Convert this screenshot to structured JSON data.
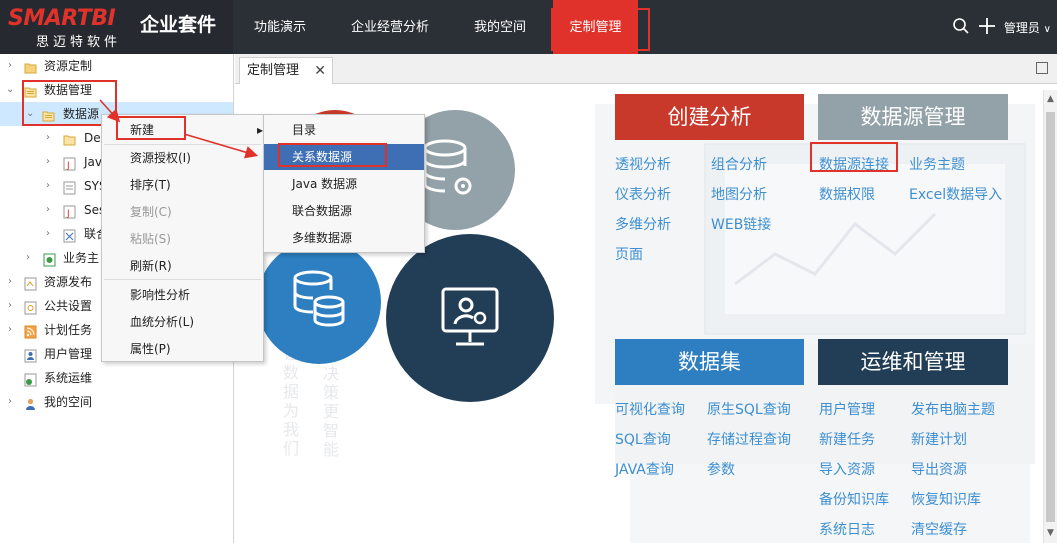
{
  "brand": {
    "logo": "SMARTBI",
    "suite": "企业套件",
    "cn_name": "思迈特软件"
  },
  "nav": [
    "功能演示",
    "企业经营分析",
    "我的空间",
    "定制管理"
  ],
  "user": {
    "label": "管理员",
    "caret": "∨"
  },
  "tree": [
    {
      "label": "资源定制"
    },
    {
      "label": "数据管理"
    },
    {
      "label": "数据源"
    },
    {
      "label": "De"
    },
    {
      "label": "Jav"
    },
    {
      "label": "SYS"
    },
    {
      "label": "Ses"
    },
    {
      "label": "联合"
    },
    {
      "label": "业务主"
    },
    {
      "label": "资源发布"
    },
    {
      "label": "公共设置"
    },
    {
      "label": "计划任务"
    },
    {
      "label": "用户管理"
    },
    {
      "label": "系统运维"
    },
    {
      "label": "我的空间"
    }
  ],
  "tab": {
    "label": "定制管理",
    "close": "✕"
  },
  "context_menu": {
    "items": [
      "新建",
      "资源授权(I)",
      "排序(T)",
      "复制(C)",
      "粘贴(S)",
      "刷新(R)",
      "影响性分析",
      "血统分析(L)",
      "属性(P)"
    ],
    "submenu_arrow": "▸"
  },
  "submenu": {
    "items": [
      "目录",
      "关系数据源",
      "Java 数据源",
      "联合数据源",
      "多维数据源"
    ]
  },
  "panels": {
    "create_analysis": {
      "title": "创建分析",
      "links": [
        "透视分析",
        "组合分析",
        "仪表分析",
        "地图分析",
        "多维分析",
        "WEB链接",
        "页面"
      ]
    },
    "datasource_mgmt": {
      "title": "数据源管理",
      "links": [
        "数据源连接",
        "业务主题",
        "数据权限",
        "Excel数据导入"
      ]
    },
    "dataset": {
      "title": "数据集",
      "links": [
        "可视化查询",
        "原生SQL查询",
        "SQL查询",
        "存储过程查询",
        "JAVA查询",
        "参数"
      ]
    },
    "ops": {
      "title": "运维和管理",
      "links": [
        "用户管理",
        "发布电脑主题",
        "新建任务",
        "新建计划",
        "导入资源",
        "导出资源",
        "备份知识库",
        "恢复知识库",
        "系统日志",
        "清空缓存"
      ]
    }
  },
  "bg_text": [
    "让",
    "数",
    "据",
    "为",
    "我",
    "们",
    "决",
    "策",
    "更",
    "智",
    "能"
  ],
  "colors": {
    "red": "#c8392b",
    "gray": "#93a1a8",
    "blue": "#2d7fc1",
    "navy": "#223d56",
    "link": "#3e8fd1"
  }
}
